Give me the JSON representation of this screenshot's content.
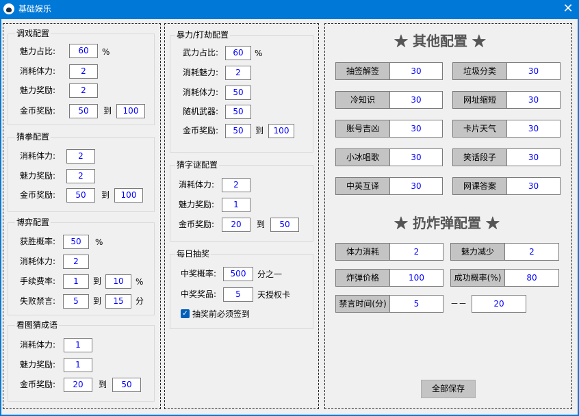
{
  "window": {
    "title": "基础娱乐",
    "close_glyph": "✕"
  },
  "tiaoxi": {
    "title": "调戏配置",
    "rows": [
      {
        "label": "魅力占比:",
        "value": "60",
        "suffix": "%"
      },
      {
        "label": "消耗体力:",
        "value": "2"
      },
      {
        "label": "魅力奖励:",
        "value": "2"
      },
      {
        "label": "金币奖励:",
        "value": "50",
        "to": "到",
        "value2": "100"
      }
    ]
  },
  "caiquan": {
    "title": "猜拳配置",
    "rows": [
      {
        "label": "消耗体力:",
        "value": "2"
      },
      {
        "label": "魅力奖励:",
        "value": "2"
      },
      {
        "label": "金币奖励:",
        "value": "50",
        "to": "到",
        "value2": "100"
      }
    ]
  },
  "boyi": {
    "title": "博弈配置",
    "rows": [
      {
        "label": "获胜概率:",
        "value": "50",
        "suffix": "%"
      },
      {
        "label": "消耗体力:",
        "value": "2"
      },
      {
        "label": "手续费率:",
        "value": "1",
        "to": "到",
        "value2": "10",
        "suffix": "%"
      },
      {
        "label": "失败禁言:",
        "value": "5",
        "to": "到",
        "value2": "15",
        "suffix": "分"
      }
    ]
  },
  "kantu": {
    "title": "看图猜成语",
    "rows": [
      {
        "label": "消耗体力:",
        "value": "1"
      },
      {
        "label": "魅力奖励:",
        "value": "1"
      },
      {
        "label": "金币奖励:",
        "value": "20",
        "to": "到",
        "value2": "50"
      }
    ]
  },
  "baoli": {
    "title": "暴力/打劫配置",
    "rows": [
      {
        "label": "武力占比:",
        "value": "60",
        "suffix": "%"
      },
      {
        "label": "消耗魅力:",
        "value": "2"
      },
      {
        "label": "消耗体力:",
        "value": "50"
      },
      {
        "label": "随机武器:",
        "value": "50"
      },
      {
        "label": "金币奖励:",
        "value": "50",
        "to": "到",
        "value2": "100"
      }
    ]
  },
  "caizimi": {
    "title": "猜字谜配置",
    "rows": [
      {
        "label": "消耗体力:",
        "value": "2"
      },
      {
        "label": "魅力奖励:",
        "value": "1"
      },
      {
        "label": "金币奖励:",
        "value": "20",
        "to": "到",
        "value2": "50"
      }
    ]
  },
  "choujiang": {
    "title": "每日抽奖",
    "rows": [
      {
        "label": "中奖概率:",
        "value": "500",
        "suffix": "分之一"
      },
      {
        "label": "中奖奖品:",
        "value": "5",
        "suffix": "天授权卡"
      }
    ],
    "checkbox_label": "抽奖前必须签到",
    "checkbox_checked": true
  },
  "other": {
    "title": "★  其他配置  ★",
    "items": [
      {
        "label": "抽签解签",
        "value": "30"
      },
      {
        "label": "垃圾分类",
        "value": "30"
      },
      {
        "label": "冷知识",
        "value": "30"
      },
      {
        "label": "网址缩短",
        "value": "30"
      },
      {
        "label": "账号吉凶",
        "value": "30"
      },
      {
        "label": "卡片天气",
        "value": "30"
      },
      {
        "label": "小冰唱歌",
        "value": "30"
      },
      {
        "label": "笑话段子",
        "value": "30"
      },
      {
        "label": "中英互译",
        "value": "30"
      },
      {
        "label": "网课答案",
        "value": "30"
      }
    ]
  },
  "bomb": {
    "title": "★  扔炸弹配置  ★",
    "items": [
      {
        "label": "体力消耗",
        "value": "2"
      },
      {
        "label": "魅力减少",
        "value": "2"
      },
      {
        "label": "炸弹价格",
        "value": "100"
      },
      {
        "label": "成功概率(%)",
        "value": "80"
      }
    ],
    "mute_label": "禁言时间(分)",
    "mute_value": "5",
    "mute_sep": "－－",
    "mute_value2": "20"
  },
  "save_button": "全部保存"
}
